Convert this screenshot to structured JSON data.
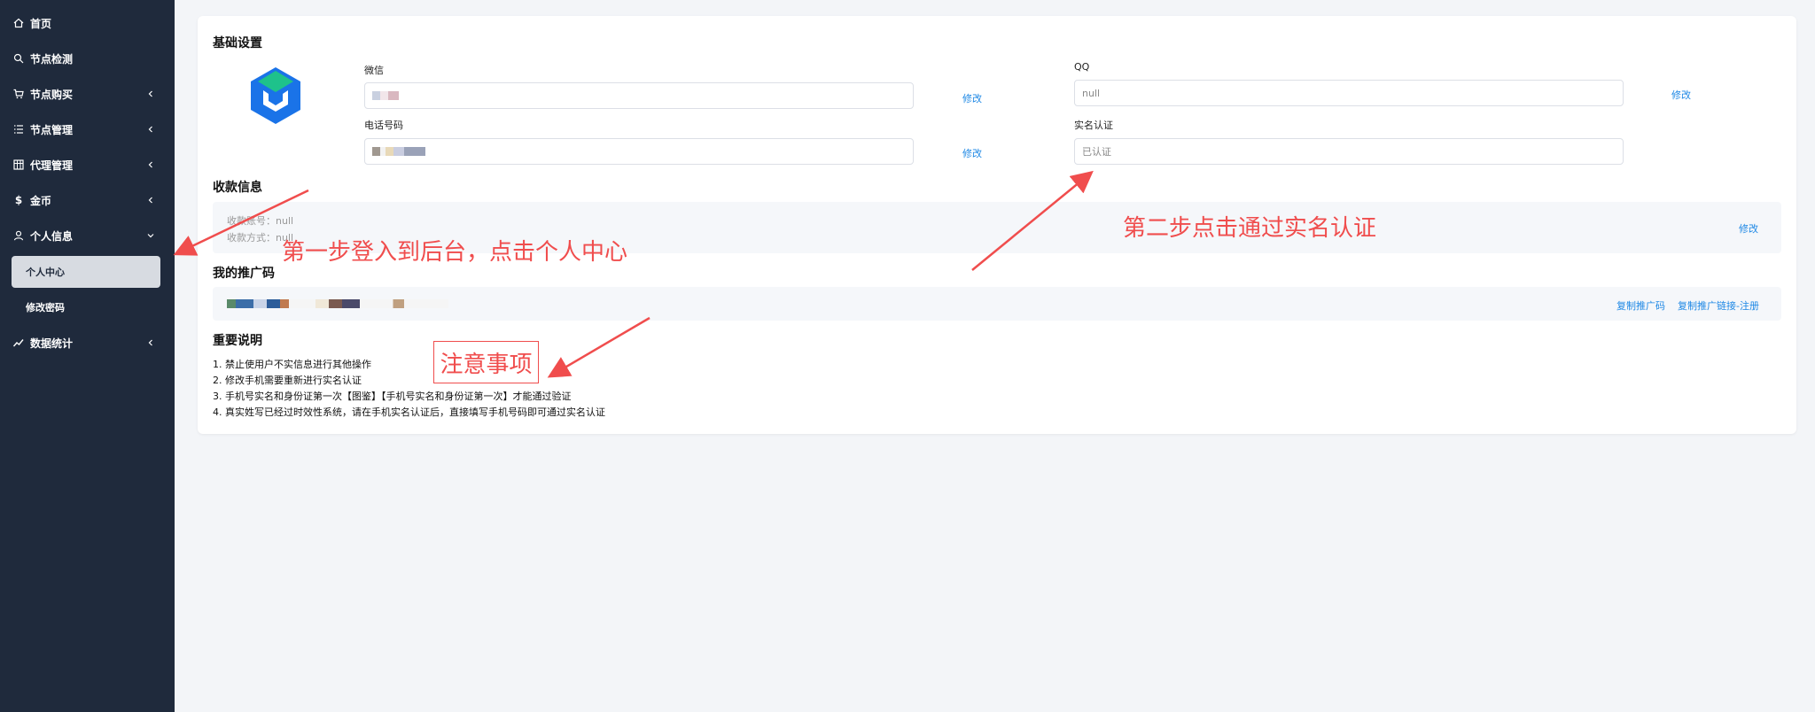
{
  "sidebar": {
    "items": [
      {
        "label": "首页",
        "icon": "home-icon"
      },
      {
        "label": "节点检测",
        "icon": "search-icon"
      },
      {
        "label": "节点购买",
        "icon": "cart-icon"
      },
      {
        "label": "节点管理",
        "icon": "list-icon"
      },
      {
        "label": "代理管理",
        "icon": "grid-icon"
      },
      {
        "label": "金币",
        "icon": "dollar-icon"
      },
      {
        "label": "个人信息",
        "icon": "user-icon"
      },
      {
        "label": "数据统计",
        "icon": "chart-icon"
      }
    ],
    "sub_items": [
      {
        "label": "个人中心",
        "active": true
      },
      {
        "label": "修改密码",
        "active": false
      }
    ]
  },
  "basic": {
    "title": "基础设置",
    "wechat_label": "微信",
    "qq_label": "QQ",
    "qq_value": "null",
    "phone_label": "电话号码",
    "realname_label": "实名认证",
    "realname_value": "已认证",
    "edit_label": "修改"
  },
  "payment": {
    "title": "收款信息",
    "account_text": "收款账号：null",
    "method_text": "收款方式：null",
    "edit_label": "修改"
  },
  "promo": {
    "title": "我的推广码",
    "copy_code_label": "复制推广码",
    "copy_link_label": "复制推广链接-注册"
  },
  "notes": {
    "title": "重要说明",
    "items": [
      "1. 禁止使用户不实信息进行其他操作",
      "2. 修改手机需要重新进行实名认证",
      "3. 手机号实名和身份证第一次【图鉴】【手机号实名和身份证第一次】才能通过验证",
      "4. 真实姓写已经过时效性系统，请在手机实名认证后，直接填写手机号码即可通过实名认证"
    ]
  },
  "annotations": {
    "step1": "第一步登入到后台，点击个人中心",
    "step2": "第二步点击通过实名认证",
    "attention": "注意事项"
  },
  "colors": {
    "sidebar_bg": "#1f2a3c",
    "accent": "#1e88e5",
    "annotation": "#f04d4d"
  }
}
